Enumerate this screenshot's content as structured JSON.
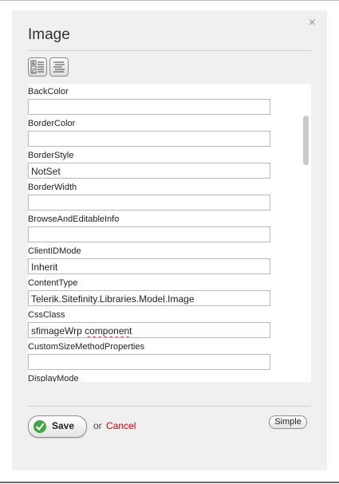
{
  "dialog": {
    "title": "Image",
    "close_glyph": "×"
  },
  "toolbar": {
    "sort_alpha_icon": "sort-alphabetical-icon",
    "categorized_icon": "categorized-list-icon"
  },
  "properties": [
    {
      "label": "BackColor",
      "value": ""
    },
    {
      "label": "BorderColor",
      "value": ""
    },
    {
      "label": "BorderStyle",
      "value": "NotSet"
    },
    {
      "label": "BorderWidth",
      "value": ""
    },
    {
      "label": "BrowseAndEditableInfo",
      "value": ""
    },
    {
      "label": "ClientIDMode",
      "value": "Inherit"
    },
    {
      "label": "ContentType",
      "value": "Telerik.Sitefinity.Libraries.Model.Image"
    },
    {
      "label": "CssClass",
      "value_part1": "sfimageWrp ",
      "value_part2": "component"
    },
    {
      "label": "CustomSizeMethodProperties",
      "value": ""
    },
    {
      "label": "DisplayMode",
      "value": ""
    }
  ],
  "footer": {
    "save_label": "Save",
    "or_text": "or",
    "cancel_label": "Cancel",
    "simple_label": "Simple"
  },
  "colors": {
    "cancel": "#cc0000",
    "save_check": "#3fa845",
    "dialog_bg": "#f0f0f0"
  }
}
